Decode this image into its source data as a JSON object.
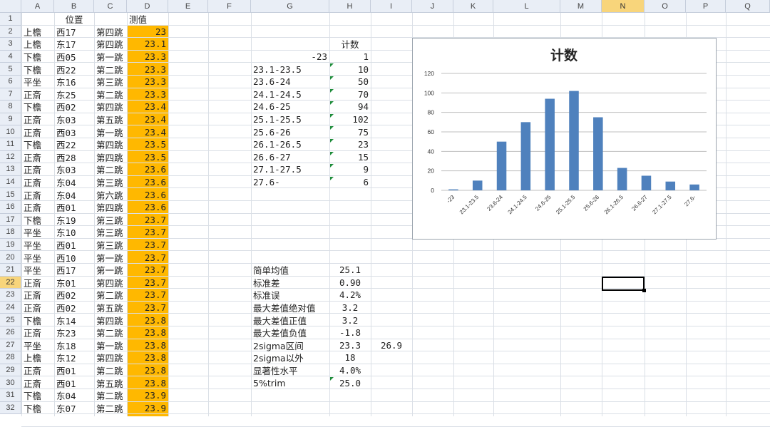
{
  "columns": [
    "A",
    "B",
    "C",
    "D",
    "E",
    "F",
    "G",
    "H",
    "I",
    "J",
    "K",
    "L",
    "M",
    "N",
    "O",
    "P",
    "Q"
  ],
  "selected_column": "N",
  "row_numbers": [
    "1",
    "2",
    "3",
    "4",
    "5",
    "6",
    "7",
    "8",
    "9",
    "10",
    "11",
    "12",
    "13",
    "14",
    "15",
    "16",
    "17",
    "18",
    "19",
    "20",
    "21",
    "22",
    "23",
    "24",
    "25",
    "26",
    "27",
    "28",
    "29",
    "30",
    "31",
    "32"
  ],
  "selected_row": "22",
  "headers": {
    "b1": "位置",
    "d1": "测值"
  },
  "table_rows": [
    [
      "上檐",
      "西17",
      "第四跳",
      "23"
    ],
    [
      "上檐",
      "东17",
      "第四跳",
      "23.1"
    ],
    [
      "下檐",
      "西05",
      "第一跳",
      "23.3"
    ],
    [
      "下檐",
      "西22",
      "第二跳",
      "23.3"
    ],
    [
      "平坐",
      "东16",
      "第三跳",
      "23.3"
    ],
    [
      "正斎",
      "东25",
      "第二跳",
      "23.3"
    ],
    [
      "下檐",
      "西02",
      "第四跳",
      "23.4"
    ],
    [
      "正斎",
      "东03",
      "第五跳",
      "23.4"
    ],
    [
      "正斎",
      "西03",
      "第一跳",
      "23.4"
    ],
    [
      "下檐",
      "西22",
      "第四跳",
      "23.5"
    ],
    [
      "正斎",
      "西28",
      "第四跳",
      "23.5"
    ],
    [
      "正斎",
      "东03",
      "第二跳",
      "23.6"
    ],
    [
      "正斎",
      "东04",
      "第三跳",
      "23.6"
    ],
    [
      "正斎",
      "东04",
      "第六跳",
      "23.6"
    ],
    [
      "正斎",
      "西01",
      "第四跳",
      "23.6"
    ],
    [
      "下檐",
      "东19",
      "第三跳",
      "23.7"
    ],
    [
      "平坐",
      "东10",
      "第三跳",
      "23.7"
    ],
    [
      "平坐",
      "西01",
      "第三跳",
      "23.7"
    ],
    [
      "平坐",
      "西10",
      "第一跳",
      "23.7"
    ],
    [
      "平坐",
      "西17",
      "第一跳",
      "23.7"
    ],
    [
      "正斎",
      "东01",
      "第四跳",
      "23.7"
    ],
    [
      "正斎",
      "西02",
      "第二跳",
      "23.7"
    ],
    [
      "正斎",
      "西02",
      "第五跳",
      "23.7"
    ],
    [
      "下檐",
      "东14",
      "第四跳",
      "23.8"
    ],
    [
      "正斎",
      "东23",
      "第二跳",
      "23.8"
    ],
    [
      "平坐",
      "东18",
      "第一跳",
      "23.8"
    ],
    [
      "上檐",
      "东12",
      "第四跳",
      "23.8"
    ],
    [
      "正斎",
      "西01",
      "第二跳",
      "23.8"
    ],
    [
      "正斎",
      "西01",
      "第五跳",
      "23.8"
    ],
    [
      "下檐",
      "东04",
      "第二跳",
      "23.9"
    ],
    [
      "下檐",
      "东07",
      "第二跳",
      "23.9"
    ]
  ],
  "freq_header": "计数",
  "freq_rows": [
    [
      "-23",
      "1"
    ],
    [
      "23.1-23.5",
      "10"
    ],
    [
      "23.6-24",
      "50"
    ],
    [
      "24.1-24.5",
      "70"
    ],
    [
      "24.6-25",
      "94"
    ],
    [
      "25.1-25.5",
      "102"
    ],
    [
      "25.6-26",
      "75"
    ],
    [
      "26.1-26.5",
      "23"
    ],
    [
      "26.6-27",
      "15"
    ],
    [
      "27.1-27.5",
      "9"
    ],
    [
      "27.6-",
      "6"
    ]
  ],
  "stats_rows": [
    [
      "简单均值",
      "25.1",
      ""
    ],
    [
      "标准差",
      "0.90",
      ""
    ],
    [
      "标准误",
      "4.2%",
      ""
    ],
    [
      "最大差值绝对值",
      "3.2",
      ""
    ],
    [
      "最大差值正值",
      "3.2",
      ""
    ],
    [
      "最大差值负值",
      "-1.8",
      ""
    ],
    [
      "2sigma区间",
      "23.3",
      "26.9"
    ],
    [
      "2sigma以外",
      "18",
      ""
    ],
    [
      "显著性水平",
      "4.0%",
      ""
    ],
    [
      "5%trim",
      "25.0",
      ""
    ]
  ],
  "chart_data": {
    "type": "bar",
    "title": "计数",
    "categories": [
      "-23",
      "23.1-23.5",
      "23.6-24",
      "24.1-24.5",
      "24.6-25",
      "25.1-25.5",
      "25.6-26",
      "26.1-26.5",
      "26.6-27",
      "27.1-27.5",
      "27.6-"
    ],
    "values": [
      1,
      10,
      50,
      70,
      94,
      102,
      75,
      23,
      15,
      9,
      6
    ],
    "ylim": [
      0,
      120
    ],
    "yticks": [
      "0",
      "20",
      "40",
      "60",
      "80",
      "100",
      "120"
    ],
    "grid": true,
    "bar_color": "#4f81bd"
  }
}
